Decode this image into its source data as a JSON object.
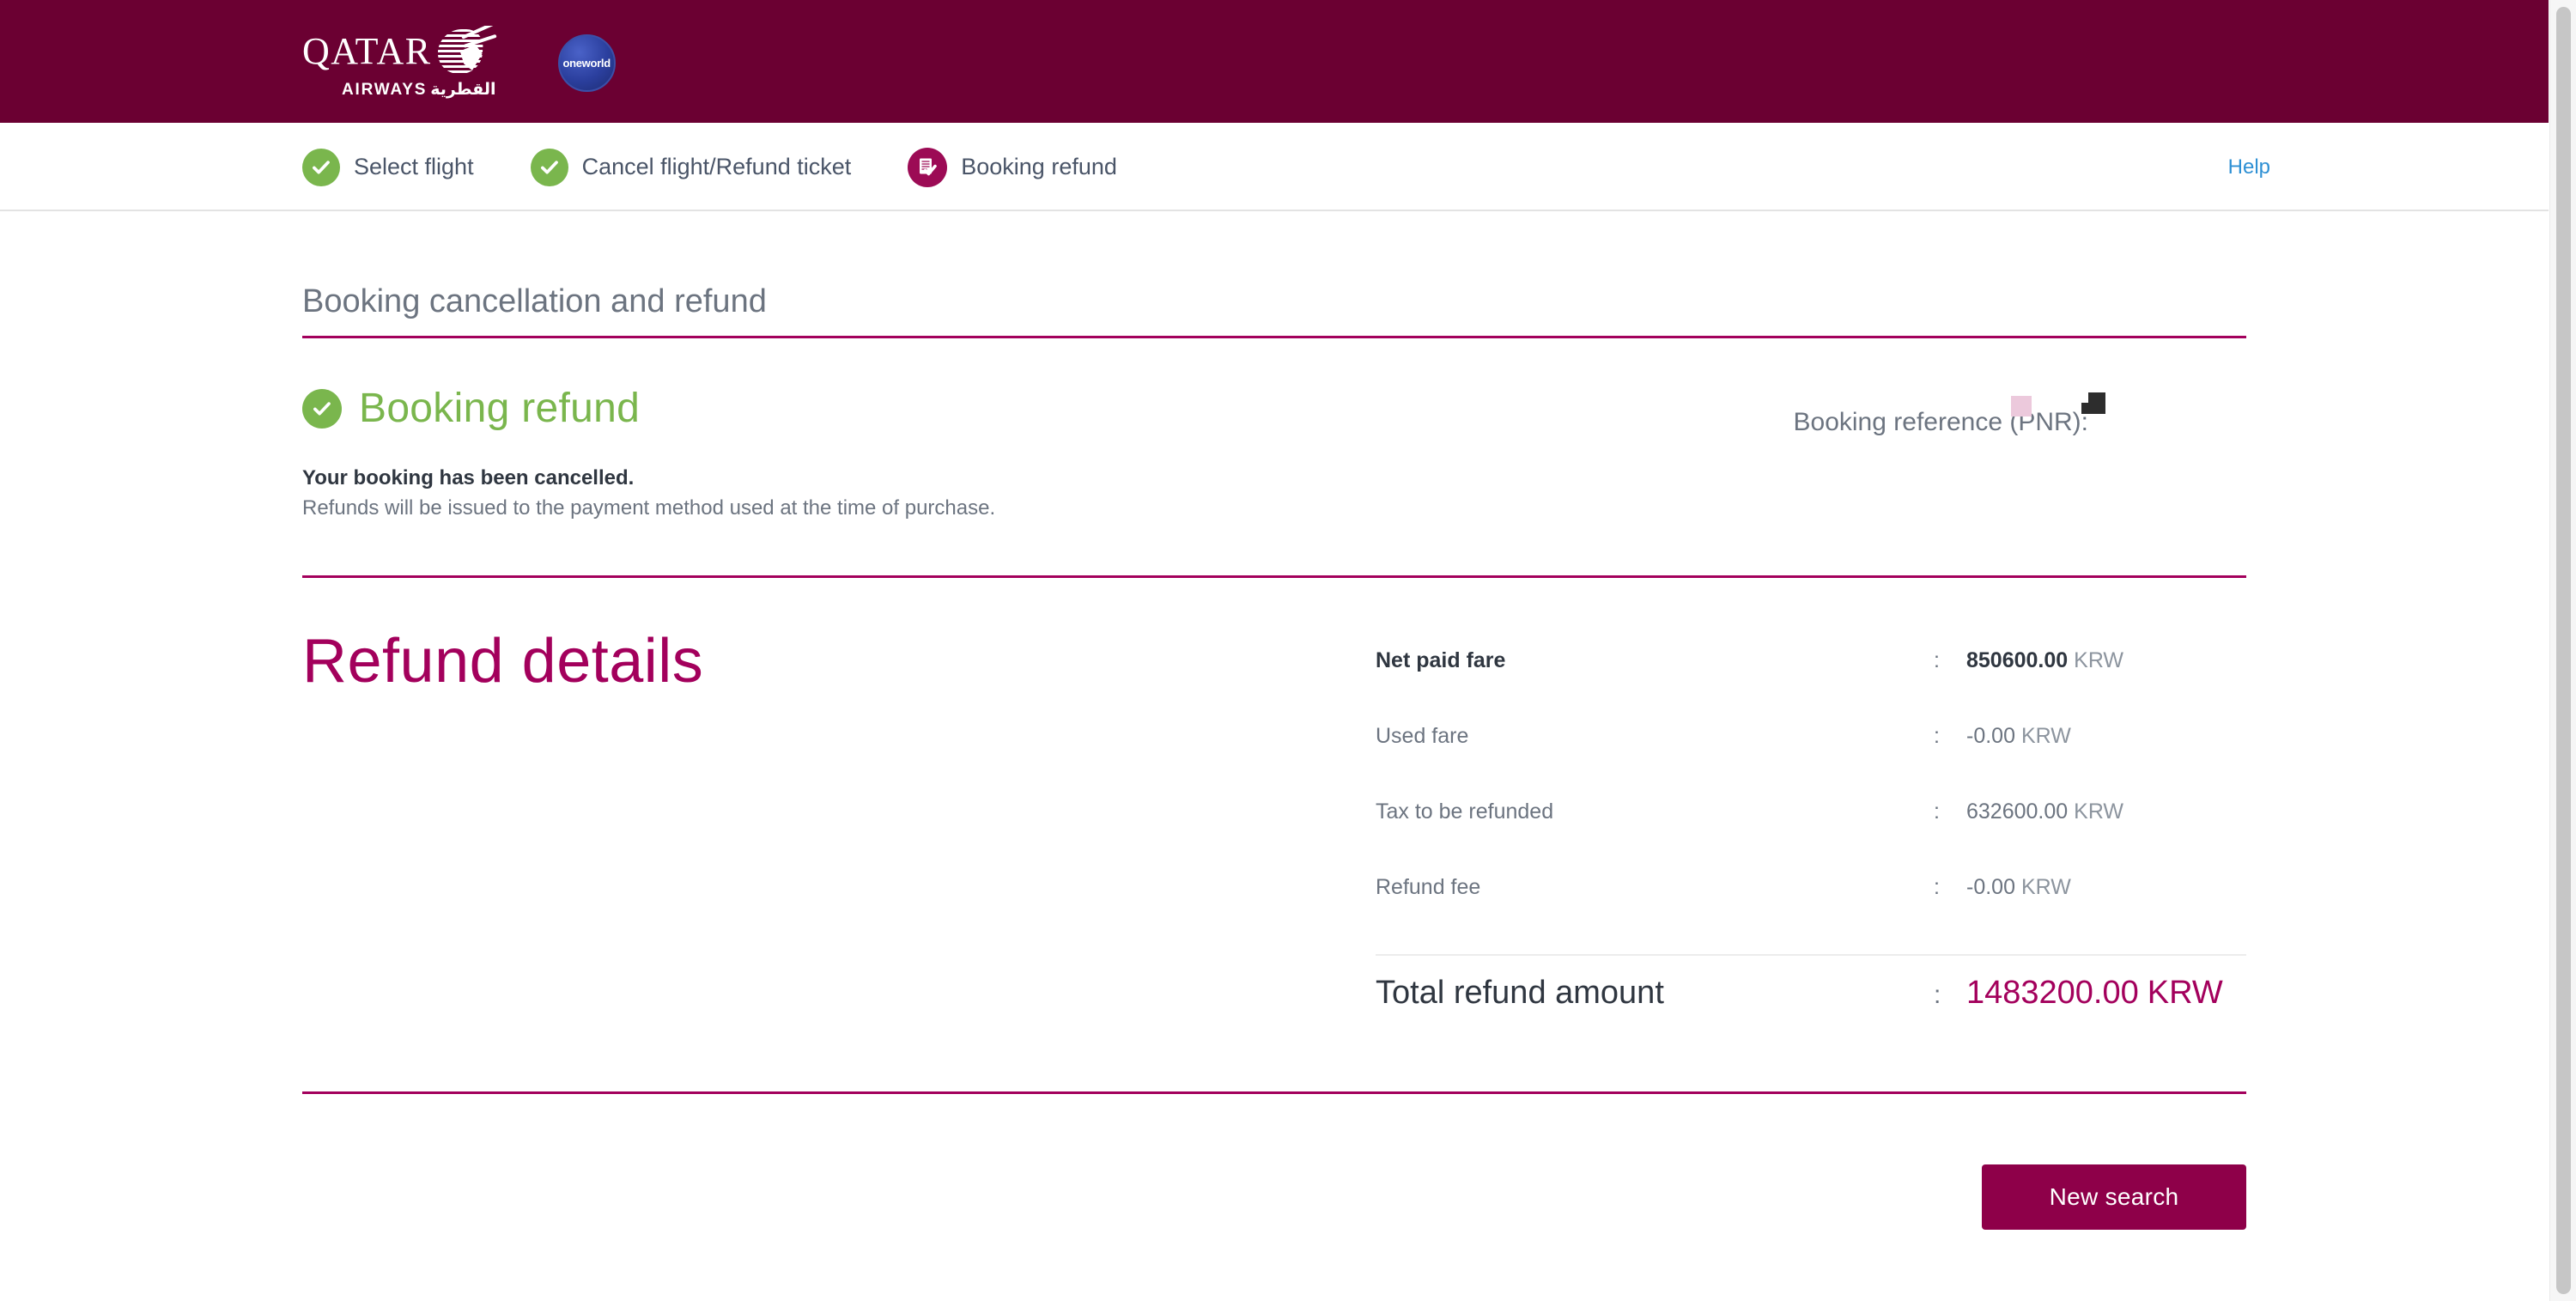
{
  "brand": {
    "airline_word": "QATAR",
    "airline_sub": "AIRWAYS",
    "airline_sub_arabic": "القطرية",
    "alliance": "oneworld"
  },
  "steps": {
    "items": [
      {
        "label": "Select flight",
        "icon": "check-circle-icon",
        "state": "completed"
      },
      {
        "label": "Cancel flight/Refund ticket",
        "icon": "check-circle-icon",
        "state": "completed"
      },
      {
        "label": "Booking refund",
        "icon": "document-check-icon",
        "state": "current"
      }
    ],
    "help_label": "Help"
  },
  "page": {
    "title": "Booking cancellation and refund"
  },
  "status": {
    "heading": "Booking refund",
    "heading_icon": "check-circle-icon",
    "message_strong": "Your booking has been cancelled.",
    "message_note": "Refunds will be issued to the payment method used at the time of purchase.",
    "pnr_label": "Booking reference (PNR):",
    "pnr_value": ""
  },
  "refund": {
    "title": "Refund details",
    "rows": [
      {
        "label": "Net paid fare",
        "amount": "850600.00",
        "currency": "KRW",
        "emphasis": true
      },
      {
        "label": "Used fare",
        "amount": "-0.00",
        "currency": "KRW",
        "emphasis": false
      },
      {
        "label": "Tax to be refunded",
        "amount": "632600.00",
        "currency": "KRW",
        "emphasis": false
      },
      {
        "label": "Refund fee",
        "amount": "-0.00",
        "currency": "KRW",
        "emphasis": false
      }
    ],
    "separator": ":",
    "total": {
      "label": "Total refund amount",
      "amount": "1483200.00",
      "currency": "KRW"
    }
  },
  "footer": {
    "new_search_label": "New search"
  },
  "colors": {
    "brand_header": "#6b0032",
    "accent_magenta": "#a3005c",
    "button_magenta": "#8e0049",
    "success_green": "#7ab64d",
    "link_blue": "#2e90d4",
    "text_gray": "#6c7480"
  }
}
